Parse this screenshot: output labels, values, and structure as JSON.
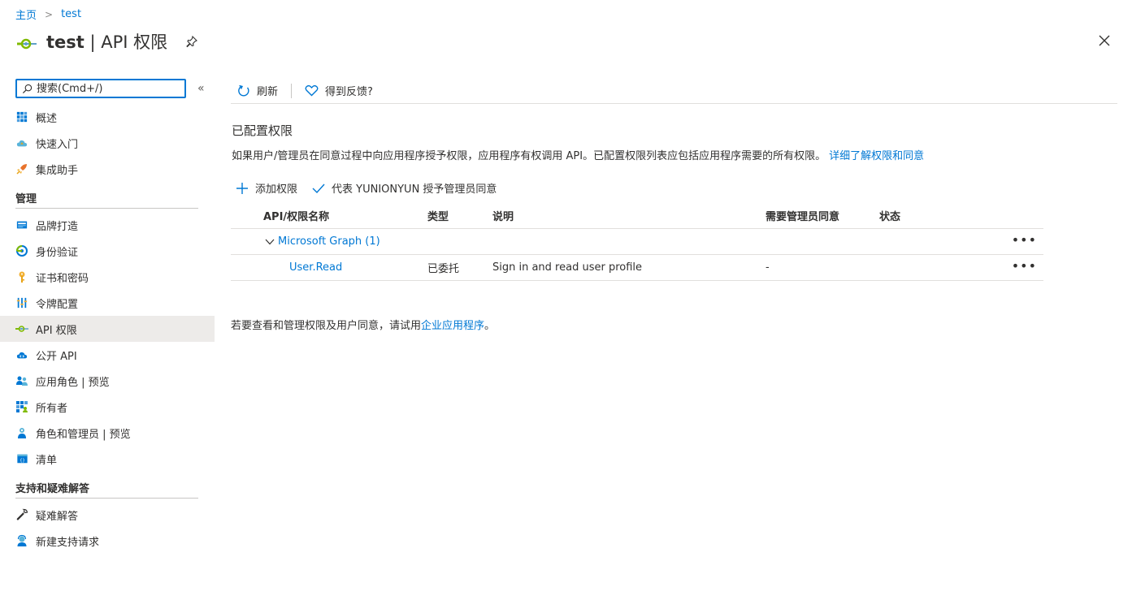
{
  "breadcrumb": {
    "home": "主页",
    "current": "test"
  },
  "header": {
    "app_name": "test",
    "title_rest": " | API 权限"
  },
  "search": {
    "placeholder": "搜索(Cmd+/)"
  },
  "collapse_label": "«",
  "sidebar": {
    "top_items": [
      {
        "label": "概述",
        "icon": "grid-icon"
      },
      {
        "label": "快速入门",
        "icon": "cloud-icon"
      },
      {
        "label": "集成助手",
        "icon": "rocket-icon"
      }
    ],
    "section_manage": "管理",
    "manage_items": [
      {
        "label": "品牌打造",
        "icon": "branding-icon"
      },
      {
        "label": "身份验证",
        "icon": "auth-icon"
      },
      {
        "label": "证书和密码",
        "icon": "key-icon"
      },
      {
        "label": "令牌配置",
        "icon": "token-icon"
      },
      {
        "label": "API 权限",
        "icon": "api-permission-icon",
        "active": true
      },
      {
        "label": "公开 API",
        "icon": "cloud-api-icon"
      },
      {
        "label": "应用角色 | 预览",
        "icon": "app-roles-icon"
      },
      {
        "label": "所有者",
        "icon": "owners-icon"
      },
      {
        "label": "角色和管理员 | 预览",
        "icon": "admin-icon"
      },
      {
        "label": "清单",
        "icon": "manifest-icon"
      }
    ],
    "section_support": "支持和疑难解答",
    "support_items": [
      {
        "label": "疑难解答",
        "icon": "wrench-icon"
      },
      {
        "label": "新建支持请求",
        "icon": "support-icon"
      }
    ]
  },
  "toolbar": {
    "refresh": "刷新",
    "feedback": "得到反馈?"
  },
  "main": {
    "section_title": "已配置权限",
    "description": "如果用户/管理员在同意过程中向应用程序授予权限，应用程序有权调用 API。已配置权限列表应包括应用程序需要的所有权限。",
    "learn_more": "详细了解权限和同意",
    "add_permission": "添加权限",
    "grant_consent": "代表 YUNIONYUN 授予管理员同意",
    "table": {
      "headers": [
        "API/权限名称",
        "类型",
        "说明",
        "需要管理员同意",
        "状态"
      ],
      "group": "Microsoft Graph (1)",
      "rows": [
        {
          "name": "User.Read",
          "type": "已委托",
          "description": "Sign in and read user profile",
          "admin_consent": "-",
          "status": ""
        }
      ],
      "more_label": "•••"
    },
    "footer_prefix": "若要查看和管理权限及用户同意，请试用",
    "footer_link": "企业应用程序",
    "footer_suffix": "。"
  },
  "colors": {
    "accent": "#0078d4",
    "active_bg": "#edebe9",
    "text": "#323130"
  }
}
